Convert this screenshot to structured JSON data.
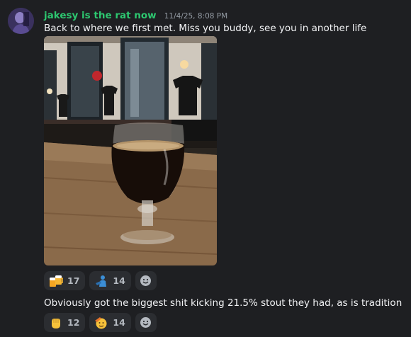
{
  "message": {
    "author": "jakesy is the rat now",
    "timestamp": "11/4/25, 8:08 PM",
    "text": "Back to where we first met. Miss you buddy, see you in another life",
    "followup_text": "Obviously got the biggest shit kicking 21.5% stout they had, as is tradition"
  },
  "colors": {
    "author": "#2dc770",
    "background": "#1e1f22",
    "reaction_bg": "#2b2d31"
  },
  "reactions_1": [
    {
      "icon": "beer-mugs-icon",
      "count": "17"
    },
    {
      "icon": "person-blue-icon",
      "count": "14"
    }
  ],
  "reactions_2": [
    {
      "icon": "raised-fist-icon",
      "count": "12"
    },
    {
      "icon": "saluting-face-icon",
      "count": "14"
    }
  ]
}
